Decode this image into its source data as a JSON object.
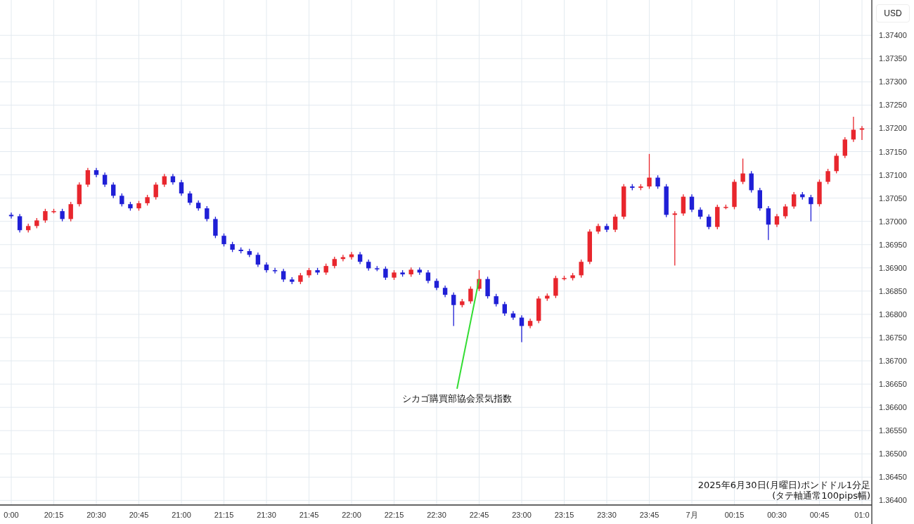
{
  "currency_button": "USD",
  "chart_data": {
    "type": "candlestick",
    "grid": true,
    "ylim": [
      1.3639,
      1.37476
    ],
    "categories": [
      "0:00",
      null,
      null,
      null,
      null,
      "20:15",
      null,
      null,
      null,
      null,
      "20:30",
      null,
      null,
      null,
      null,
      "20:45",
      null,
      null,
      null,
      null,
      "21:00",
      null,
      null,
      null,
      null,
      "21:15",
      null,
      null,
      null,
      null,
      "21:30",
      null,
      null,
      null,
      null,
      "21:45",
      null,
      null,
      null,
      null,
      "22:00",
      null,
      null,
      null,
      null,
      "22:15",
      null,
      null,
      null,
      null,
      "22:30",
      null,
      null,
      null,
      null,
      "22:45",
      null,
      null,
      null,
      null,
      "23:00",
      null,
      null,
      null,
      null,
      "23:15",
      null,
      null,
      null,
      null,
      "23:30",
      null,
      null,
      null,
      null,
      "23:45",
      null,
      null,
      null,
      null,
      "7月",
      null,
      null,
      null,
      null,
      "00:15",
      null,
      null,
      null,
      null,
      "00:30",
      null,
      null,
      null,
      null,
      "00:45",
      null,
      null,
      null,
      null,
      "01:0"
    ],
    "ohlc": [
      [
        1.37014,
        1.37019,
        1.37006,
        1.37011
      ],
      [
        1.37011,
        1.37016,
        1.36976,
        1.36981
      ],
      [
        1.36981,
        1.36995,
        1.36976,
        1.3699
      ],
      [
        1.3699,
        1.37007,
        1.36985,
        1.37002
      ],
      [
        1.37002,
        1.37027,
        1.36997,
        1.37022
      ],
      [
        1.37022,
        1.37027,
        1.37017,
        1.37022
      ],
      [
        1.37022,
        1.37027,
        1.37,
        1.37005
      ],
      [
        1.37005,
        1.37042,
        1.37,
        1.37037
      ],
      [
        1.37037,
        1.37084,
        1.37032,
        1.37079
      ],
      [
        1.37079,
        1.37115,
        1.37074,
        1.3711
      ],
      [
        1.3711,
        1.37115,
        1.37095,
        1.371
      ],
      [
        1.371,
        1.37105,
        1.37074,
        1.37079
      ],
      [
        1.37079,
        1.37084,
        1.3705,
        1.37055
      ],
      [
        1.37055,
        1.3706,
        1.37032,
        1.37037
      ],
      [
        1.37037,
        1.37042,
        1.37023,
        1.37028
      ],
      [
        1.37028,
        1.37044,
        1.37023,
        1.37039
      ],
      [
        1.37039,
        1.37057,
        1.37034,
        1.37052
      ],
      [
        1.37052,
        1.37084,
        1.37047,
        1.37079
      ],
      [
        1.37079,
        1.37102,
        1.37074,
        1.37097
      ],
      [
        1.37097,
        1.37102,
        1.37079,
        1.37084
      ],
      [
        1.37084,
        1.37089,
        1.37055,
        1.3706
      ],
      [
        1.3706,
        1.37065,
        1.37035,
        1.3704
      ],
      [
        1.3704,
        1.37045,
        1.37023,
        1.37028
      ],
      [
        1.37028,
        1.37033,
        1.37,
        1.37005
      ],
      [
        1.37005,
        1.3701,
        1.36964,
        1.36969
      ],
      [
        1.36969,
        1.36974,
        1.36946,
        1.36951
      ],
      [
        1.36951,
        1.36956,
        1.36934,
        1.36939
      ],
      [
        1.36939,
        1.36944,
        1.36931,
        1.36936
      ],
      [
        1.36936,
        1.36941,
        1.36923,
        1.36928
      ],
      [
        1.36928,
        1.36933,
        1.36902,
        1.36907
      ],
      [
        1.36907,
        1.36912,
        1.3689,
        1.36895
      ],
      [
        1.36895,
        1.369,
        1.36888,
        1.36893
      ],
      [
        1.36893,
        1.36898,
        1.3687,
        1.36875
      ],
      [
        1.36875,
        1.3688,
        1.36865,
        1.3687
      ],
      [
        1.3687,
        1.36889,
        1.36865,
        1.36884
      ],
      [
        1.36884,
        1.369,
        1.36879,
        1.36895
      ],
      [
        1.36895,
        1.369,
        1.36885,
        1.3689
      ],
      [
        1.3689,
        1.36909,
        1.36885,
        1.36904
      ],
      [
        1.36904,
        1.36924,
        1.36899,
        1.36919
      ],
      [
        1.36919,
        1.36928,
        1.36914,
        1.36923
      ],
      [
        1.36923,
        1.36934,
        1.36918,
        1.36929
      ],
      [
        1.36929,
        1.36934,
        1.36908,
        1.36913
      ],
      [
        1.36913,
        1.36918,
        1.36894,
        1.36899
      ],
      [
        1.36899,
        1.36904,
        1.36893,
        1.36898
      ],
      [
        1.36898,
        1.36903,
        1.36874,
        1.36879
      ],
      [
        1.36879,
        1.36895,
        1.36874,
        1.3689
      ],
      [
        1.3689,
        1.36895,
        1.36881,
        1.36886
      ],
      [
        1.36886,
        1.36901,
        1.36881,
        1.36896
      ],
      [
        1.36896,
        1.36901,
        1.36885,
        1.3689
      ],
      [
        1.3689,
        1.36895,
        1.36867,
        1.36872
      ],
      [
        1.36872,
        1.36877,
        1.36852,
        1.36857
      ],
      [
        1.36857,
        1.36862,
        1.36837,
        1.36842
      ],
      [
        1.36842,
        1.36847,
        1.36775,
        1.3682
      ],
      [
        1.3682,
        1.36833,
        1.36815,
        1.36828
      ],
      [
        1.36828,
        1.3686,
        1.36823,
        1.36855
      ],
      [
        1.36855,
        1.36895,
        1.3685,
        1.36876
      ],
      [
        1.36876,
        1.36881,
        1.36834,
        1.36839
      ],
      [
        1.36839,
        1.36844,
        1.36817,
        1.36822
      ],
      [
        1.36822,
        1.36827,
        1.36797,
        1.36802
      ],
      [
        1.36802,
        1.36807,
        1.36788,
        1.36793
      ],
      [
        1.36793,
        1.36798,
        1.3674,
        1.36775
      ],
      [
        1.36775,
        1.36791,
        1.3677,
        1.36786
      ],
      [
        1.36786,
        1.36839,
        1.36781,
        1.36834
      ],
      [
        1.36834,
        1.36845,
        1.36829,
        1.3684
      ],
      [
        1.3684,
        1.36883,
        1.36835,
        1.36878
      ],
      [
        1.36878,
        1.36883,
        1.36873,
        1.36878
      ],
      [
        1.36878,
        1.36889,
        1.36873,
        1.36884
      ],
      [
        1.36884,
        1.36918,
        1.36879,
        1.36913
      ],
      [
        1.36913,
        1.36983,
        1.36908,
        1.36978
      ],
      [
        1.36978,
        1.36995,
        1.36973,
        1.3699
      ],
      [
        1.3699,
        1.36995,
        1.36977,
        1.36982
      ],
      [
        1.36982,
        1.37015,
        1.36977,
        1.3701
      ],
      [
        1.3701,
        1.3708,
        1.37005,
        1.37075
      ],
      [
        1.37075,
        1.3708,
        1.37067,
        1.37072
      ],
      [
        1.37072,
        1.3708,
        1.37067,
        1.37075
      ],
      [
        1.37075,
        1.37145,
        1.3707,
        1.37094
      ],
      [
        1.37094,
        1.37099,
        1.3707,
        1.37075
      ],
      [
        1.37075,
        1.3708,
        1.37009,
        1.37014
      ],
      [
        1.37014,
        1.37022,
        1.36905,
        1.37017
      ],
      [
        1.37017,
        1.37058,
        1.37012,
        1.37053
      ],
      [
        1.37053,
        1.37058,
        1.3702,
        1.37025
      ],
      [
        1.37025,
        1.3703,
        1.37005,
        1.3701
      ],
      [
        1.3701,
        1.37015,
        1.36983,
        1.36988
      ],
      [
        1.36988,
        1.37036,
        1.36983,
        1.37031
      ],
      [
        1.37031,
        1.37036,
        1.37026,
        1.37031
      ],
      [
        1.37031,
        1.3709,
        1.37026,
        1.37085
      ],
      [
        1.37085,
        1.37135,
        1.3708,
        1.37103
      ],
      [
        1.37103,
        1.37108,
        1.37062,
        1.37067
      ],
      [
        1.37067,
        1.37072,
        1.37023,
        1.37028
      ],
      [
        1.37028,
        1.37033,
        1.3696,
        1.36993
      ],
      [
        1.36993,
        1.37016,
        1.36988,
        1.37011
      ],
      [
        1.37011,
        1.37037,
        1.37006,
        1.37032
      ],
      [
        1.37032,
        1.37063,
        1.37027,
        1.37058
      ],
      [
        1.37058,
        1.37063,
        1.37047,
        1.37052
      ],
      [
        1.37052,
        1.37057,
        1.37,
        1.37037
      ],
      [
        1.37037,
        1.3709,
        1.37032,
        1.37085
      ],
      [
        1.37085,
        1.37113,
        1.3708,
        1.37108
      ],
      [
        1.37108,
        1.37146,
        1.37103,
        1.37141
      ],
      [
        1.37141,
        1.37181,
        1.37136,
        1.37176
      ],
      [
        1.37176,
        1.37225,
        1.37171,
        1.37197
      ],
      [
        1.37197,
        1.37205,
        1.37175,
        1.372
      ]
    ],
    "yticks": [
      {
        "value": 1.374,
        "label": "1.37400"
      },
      {
        "value": 1.3735,
        "label": "1.37350"
      },
      {
        "value": 1.373,
        "label": "1.37300"
      },
      {
        "value": 1.3725,
        "label": "1.37250"
      },
      {
        "value": 1.372,
        "label": "1.37200"
      },
      {
        "value": 1.3715,
        "label": "1.37150"
      },
      {
        "value": 1.371,
        "label": "1.37100"
      },
      {
        "value": 1.3705,
        "label": "1.37050"
      },
      {
        "value": 1.37,
        "label": "1.37000"
      },
      {
        "value": 1.3695,
        "label": "1.36950"
      },
      {
        "value": 1.369,
        "label": "1.36900"
      },
      {
        "value": 1.3685,
        "label": "1.36850"
      },
      {
        "value": 1.368,
        "label": "1.36800"
      },
      {
        "value": 1.3675,
        "label": "1.36750"
      },
      {
        "value": 1.367,
        "label": "1.36700"
      },
      {
        "value": 1.3665,
        "label": "1.36650"
      },
      {
        "value": 1.366,
        "label": "1.36600"
      },
      {
        "value": 1.3655,
        "label": "1.36550"
      },
      {
        "value": 1.365,
        "label": "1.36500"
      },
      {
        "value": 1.3645,
        "label": "1.36450"
      },
      {
        "value": 1.364,
        "label": "1.36400"
      }
    ],
    "annotations": [
      {
        "text": "シカゴ購買部協会景気指数",
        "x": "22:45",
        "y": 1.36876
      }
    ]
  },
  "caption": [
    "2025年6月30日(月曜日)ポンドドル1分足",
    "(タテ軸通常100pips幅)"
  ]
}
